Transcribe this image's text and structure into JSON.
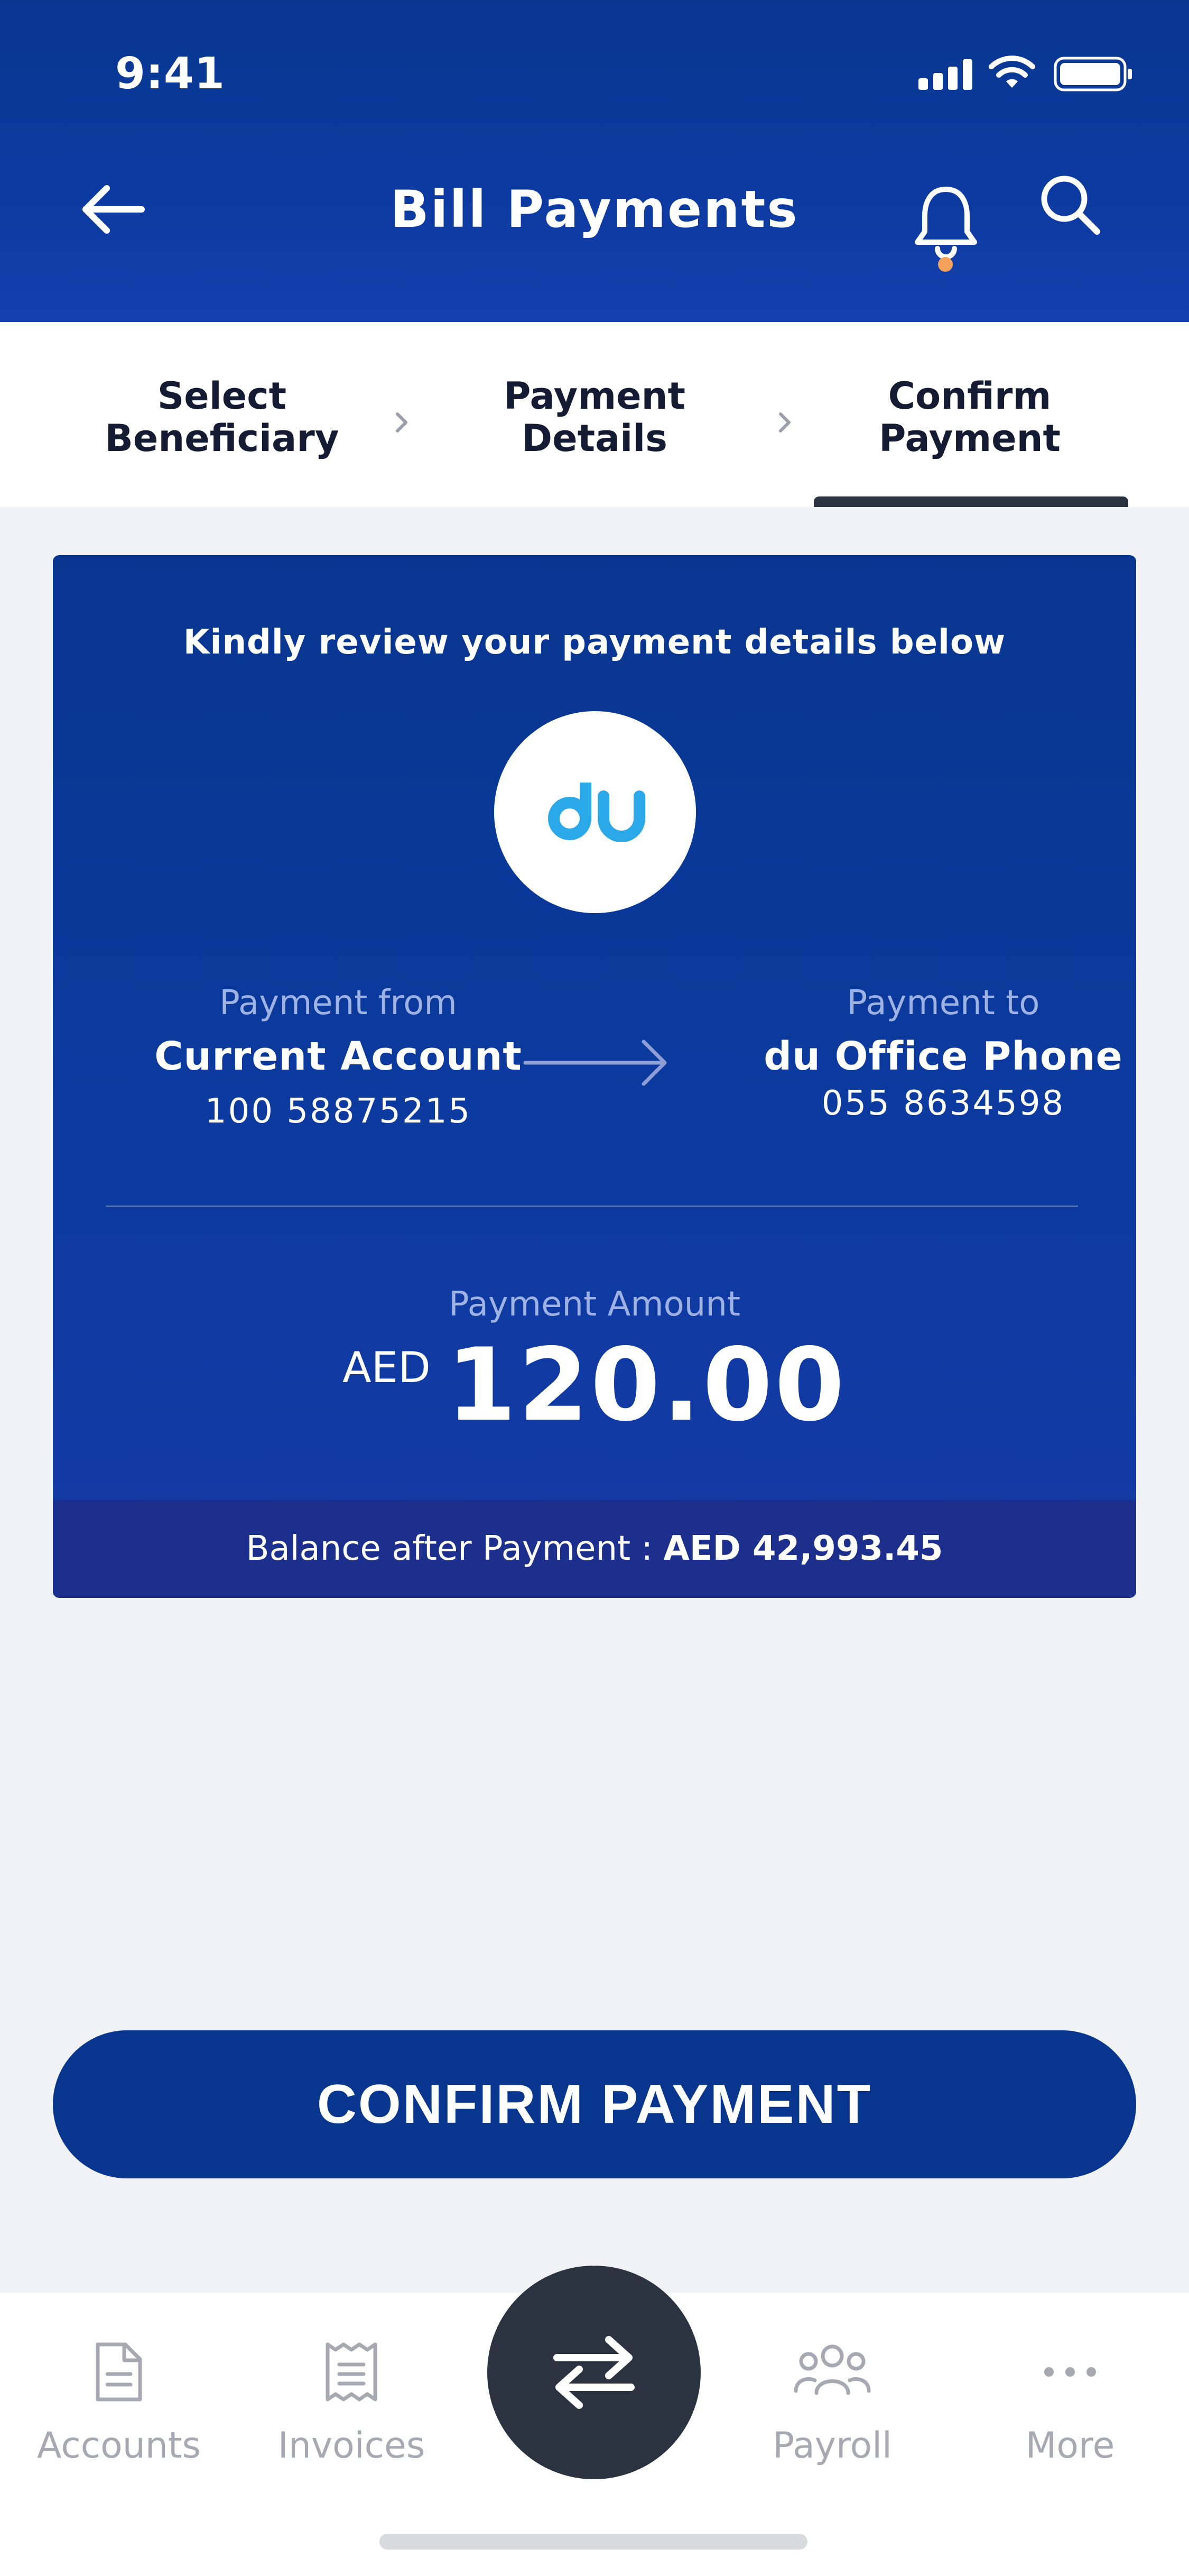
{
  "status_bar": {
    "time": "9:41"
  },
  "header": {
    "title": "Bill Payments",
    "colors": {
      "primary": "#08368f",
      "notification_dot": "#f5a25d"
    }
  },
  "stepper": {
    "steps": [
      {
        "label_line1": "Select",
        "label_line2": "Beneficiary",
        "active": false
      },
      {
        "label_line1": "Payment",
        "label_line2": "Details",
        "active": false
      },
      {
        "label_line1": "Confirm",
        "label_line2": "Payment",
        "active": true
      }
    ]
  },
  "review": {
    "title": "Kindly review your payment details below",
    "biller_logo": "du-logo",
    "from": {
      "label": "Payment from",
      "name": "Current Account",
      "number": "100 58875215"
    },
    "to": {
      "label": "Payment to",
      "name": "du Office Phone",
      "number": "055 8634598"
    },
    "amount_label": "Payment Amount",
    "currency": "AED",
    "amount": "120.00",
    "balance_label": "Balance after Payment : ",
    "balance_value": "AED 42,993.45"
  },
  "confirm_button": {
    "label": "CONFIRM PAYMENT"
  },
  "bottom_nav": {
    "items": [
      {
        "label": "Accounts",
        "icon": "document-icon"
      },
      {
        "label": "Invoices",
        "icon": "receipt-icon"
      },
      {
        "label": "",
        "icon": "transfer-icon"
      },
      {
        "label": "Payroll",
        "icon": "people-icon"
      },
      {
        "label": "More",
        "icon": "more-dots-icon"
      }
    ]
  }
}
